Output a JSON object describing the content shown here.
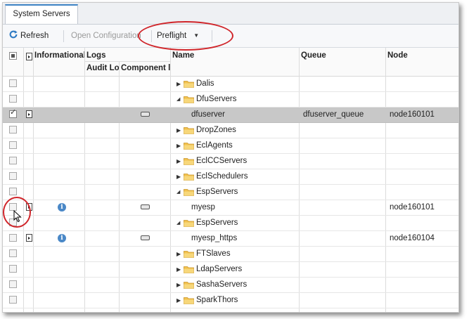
{
  "tab": {
    "label": "System Servers"
  },
  "toolbar": {
    "refresh": "Refresh",
    "open_configuration": "Open Configuration",
    "preflight": "Preflight"
  },
  "columns": {
    "informational": "Informational",
    "logs": "Logs",
    "audit_log": "Audit Lo",
    "component_log": "Component l",
    "name": "Name",
    "queue": "Queue",
    "node": "Node"
  },
  "rows": [
    {
      "type": "folder",
      "expanded": false,
      "name": "Dalis",
      "queue": "",
      "node": ""
    },
    {
      "type": "folder",
      "expanded": true,
      "name": "DfuServers",
      "queue": "",
      "node": ""
    },
    {
      "type": "server",
      "selected": true,
      "checked": true,
      "info": false,
      "name": "dfuserver",
      "queue": "dfuserver_queue",
      "node": "node160101"
    },
    {
      "type": "folder",
      "expanded": false,
      "name": "DropZones",
      "queue": "",
      "node": ""
    },
    {
      "type": "folder",
      "expanded": false,
      "name": "EclAgents",
      "queue": "",
      "node": ""
    },
    {
      "type": "folder",
      "expanded": false,
      "name": "EclCCServers",
      "queue": "",
      "node": ""
    },
    {
      "type": "folder",
      "expanded": false,
      "name": "EclSchedulers",
      "queue": "",
      "node": ""
    },
    {
      "type": "folder",
      "expanded": true,
      "name": "EspServers",
      "queue": "",
      "node": ""
    },
    {
      "type": "server",
      "selected": false,
      "checked": false,
      "info": true,
      "name": "myesp",
      "queue": "",
      "node": "node160101"
    },
    {
      "type": "folder",
      "expanded": true,
      "name": "EspServers",
      "queue": "",
      "node": ""
    },
    {
      "type": "server",
      "selected": false,
      "checked": false,
      "info": true,
      "name": "myesp_https",
      "queue": "",
      "node": "node160104"
    },
    {
      "type": "folder",
      "expanded": false,
      "name": "FTSlaves",
      "queue": "",
      "node": ""
    },
    {
      "type": "folder",
      "expanded": false,
      "name": "LdapServers",
      "queue": "",
      "node": ""
    },
    {
      "type": "folder",
      "expanded": false,
      "name": "SashaServers",
      "queue": "",
      "node": ""
    },
    {
      "type": "folder",
      "expanded": false,
      "name": "SparkThors",
      "queue": "",
      "node": ""
    }
  ],
  "colors": {
    "accent": "#3d83c4",
    "annotation": "#d0252a",
    "selected_row": "#c8c8c8",
    "folder": "#f2c14e"
  }
}
